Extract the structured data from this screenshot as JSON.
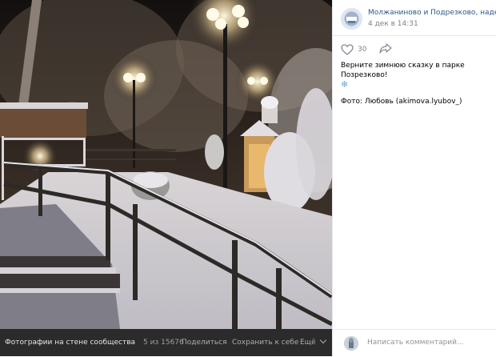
{
  "photo_bar": {
    "label": "Фотографии на стене сообщества",
    "counter": "5 из 15676",
    "share": "Поделиться",
    "save": "Сохранить к себе",
    "more": "Ещё"
  },
  "post": {
    "author": "Молжаниново и Подрезково, наде",
    "date": "4 дек в 14:31",
    "likes": "30",
    "text_line1": "Верните зимнюю сказку в парке Позрезково!",
    "emoji": "❄",
    "credit": "Фото: Любовь (akimova.lyubov_)"
  },
  "comment": {
    "placeholder": "Написать комментарий..."
  },
  "colors": {
    "link": "#2a5885",
    "muted": "#828282",
    "bar_bg": "#2b2b2b"
  }
}
